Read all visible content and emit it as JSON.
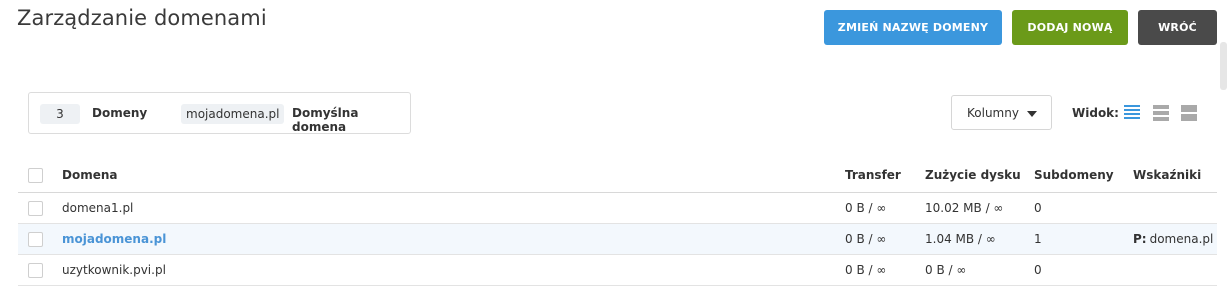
{
  "header": {
    "title": "Zarządzanie domenami",
    "rename_label": "ZMIEŃ NAZWĘ DOMENY",
    "add_label": "DODAJ NOWĄ",
    "back_label": "WRÓĆ"
  },
  "stats": {
    "count": "3",
    "count_label": "Domeny",
    "default_value": "mojadomena.pl",
    "default_label": "Domyślna domena"
  },
  "toolbar": {
    "columns_label": "Kolumny",
    "view_label": "Widok:",
    "view_icons": [
      "list-view-icon",
      "compact-view-icon",
      "large-view-icon"
    ],
    "active_view": "list"
  },
  "table": {
    "headers": {
      "domain": "Domena",
      "transfer": "Transfer",
      "disk": "Zużycie dysku",
      "subdomains": "Subdomeny",
      "indicators": "Wskaźniki"
    },
    "rows": [
      {
        "domain": "domena1.pl",
        "transfer": "0 B / ∞",
        "disk": "10.02 MB / ∞",
        "subdomains": "0",
        "indicator_key": "",
        "indicator_value": ""
      },
      {
        "domain": "mojadomena.pl",
        "transfer": "0 B / ∞",
        "disk": "1.04 MB / ∞",
        "subdomains": "1",
        "indicator_key": "P:",
        "indicator_value": "domena.pl"
      },
      {
        "domain": "uzytkownik.pvi.pl",
        "transfer": "0 B / ∞",
        "disk": "0 B / ∞",
        "subdomains": "0",
        "indicator_key": "",
        "indicator_value": ""
      }
    ]
  },
  "colors": {
    "rename_button": "#3b97dd",
    "add_button": "#6b9a19",
    "back_button": "#4a4a4a",
    "link": "#4a94d6",
    "highlight_row": "#f3f8fd"
  }
}
